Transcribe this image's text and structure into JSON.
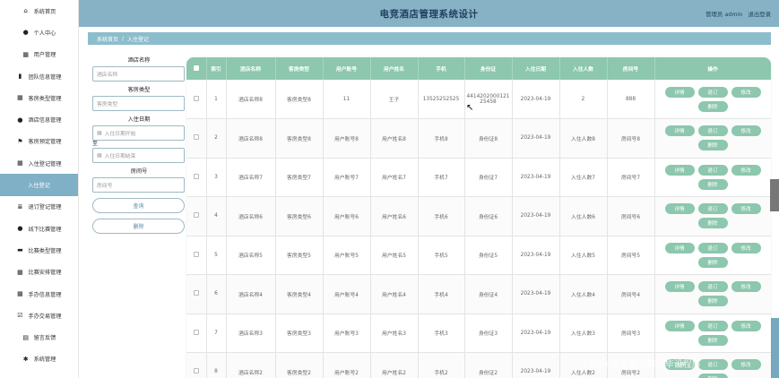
{
  "header": {
    "title": "电竞酒店管理系统设计",
    "user_label": "管理员 admin",
    "logout": "退出登录"
  },
  "sidebar": {
    "items": [
      {
        "label": "系统首页",
        "icon": "home-icon",
        "glyph": "⌂"
      },
      {
        "label": "个人中心",
        "icon": "user-icon",
        "glyph": "●"
      },
      {
        "label": "用户管理",
        "icon": "grid-icon",
        "glyph": "▦"
      },
      {
        "label": "团队信息管理",
        "icon": "bar-chart-icon",
        "glyph": "▮"
      },
      {
        "label": "客房类型管理",
        "icon": "grid-icon",
        "glyph": "▦"
      },
      {
        "label": "酒店信息管理",
        "icon": "location-icon",
        "glyph": "●"
      },
      {
        "label": "客房预定管理",
        "icon": "flag-icon",
        "glyph": "⚑"
      },
      {
        "label": "入住登记管理",
        "icon": "grid-icon",
        "glyph": "▦"
      },
      {
        "label": "入住登记",
        "icon": "",
        "glyph": "",
        "active": true
      },
      {
        "label": "退订登记管理",
        "icon": "list-icon",
        "glyph": "≣"
      },
      {
        "label": "线下比赛管理",
        "icon": "user-icon",
        "glyph": "●"
      },
      {
        "label": "比赛类型管理",
        "icon": "briefcase-icon",
        "glyph": "▬"
      },
      {
        "label": "比赛安排管理",
        "icon": "grid-icon",
        "glyph": "▦"
      },
      {
        "label": "手办信息管理",
        "icon": "grid-icon",
        "glyph": "▦"
      },
      {
        "label": "手办交易管理",
        "icon": "check-square-icon",
        "glyph": "☑"
      },
      {
        "label": "留言反馈",
        "icon": "calendar-icon",
        "glyph": "▤"
      },
      {
        "label": "系统管理",
        "icon": "bug-icon",
        "glyph": "✱"
      }
    ]
  },
  "breadcrumb": {
    "home": "系统首页",
    "separator": "/",
    "current": "入住登记"
  },
  "search": {
    "hotel_label": "酒店名称",
    "hotel_placeholder": "酒店名称",
    "room_type_label": "客房类型",
    "room_type_placeholder": "客房类型",
    "date_label": "入住日期",
    "date_start_placeholder": "入住日期开始",
    "to": "至",
    "date_end_placeholder": "入住日期结束",
    "room_no_label": "房间号",
    "room_no_placeholder": "房间号",
    "query_button": "查询",
    "delete_button": "删除"
  },
  "table": {
    "columns": [
      "索引",
      "酒店名称",
      "客房类型",
      "用户账号",
      "用户姓名",
      "手机",
      "身份证",
      "入住日期",
      "入住人数",
      "房间号",
      "操作"
    ],
    "actions": [
      "详情",
      "退订",
      "修改",
      "删除"
    ],
    "rows": [
      [
        "1",
        "酒店名称8",
        "客房类型8",
        "11",
        "王子",
        "13525252525",
        "441420200012125458",
        "2023-04-19",
        "2",
        "888"
      ],
      [
        "2",
        "酒店名称8",
        "客房类型8",
        "用户账号8",
        "用户姓名8",
        "手机8",
        "身份证8",
        "2023-04-19",
        "入住人数8",
        "房间号8"
      ],
      [
        "3",
        "酒店名称7",
        "客房类型7",
        "用户账号7",
        "用户姓名7",
        "手机7",
        "身份证7",
        "2023-04-19",
        "入住人数7",
        "房间号7"
      ],
      [
        "4",
        "酒店名称6",
        "客房类型6",
        "用户账号6",
        "用户姓名6",
        "手机6",
        "身份证6",
        "2023-04-19",
        "入住人数6",
        "房间号6"
      ],
      [
        "5",
        "酒店名称5",
        "客房类型5",
        "用户账号5",
        "用户姓名5",
        "手机5",
        "身份证5",
        "2023-04-19",
        "入住人数5",
        "房间号5"
      ],
      [
        "6",
        "酒店名称4",
        "客房类型4",
        "用户账号4",
        "用户姓名4",
        "手机4",
        "身份证4",
        "2023-04-19",
        "入住人数4",
        "房间号4"
      ],
      [
        "7",
        "酒店名称3",
        "客房类型3",
        "用户账号3",
        "用户姓名3",
        "手机3",
        "身份证3",
        "2023-04-19",
        "入住人数3",
        "房间号3"
      ],
      [
        "8",
        "酒店名称2",
        "客房类型2",
        "用户账号2",
        "用户姓名2",
        "手机2",
        "身份证2",
        "2023-04-19",
        "入住人数2",
        "房间号2"
      ]
    ]
  },
  "watermark": "CSDN @学姐计算机毕设程序",
  "colors": {
    "header": "#87b2c6",
    "accent": "#8cc7ae",
    "active_nav": "#7fb0c6"
  }
}
